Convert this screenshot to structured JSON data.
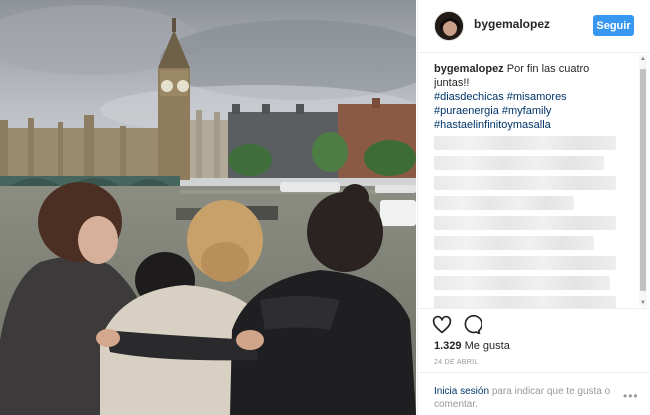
{
  "post": {
    "image_alt": "",
    "username": "bygemalopez",
    "follow_label": "Seguir",
    "caption_user": "bygemalopez",
    "caption_text": "Por fin las cuatro juntas!!",
    "hashtags": [
      "#diasdechicas",
      "#misamores",
      "#puraenergia",
      "#myfamily",
      "#hastaelinfinitoymasalla"
    ],
    "likes_count": "1.329",
    "likes_label": "Me gusta",
    "date": "24 DE ABRIL",
    "login_link": "Inicia sesión",
    "login_rest": "para indicar que te gusta o comentar.",
    "more_label": "•••"
  },
  "icons": {
    "like": "heart-icon",
    "comment": "comment-icon",
    "more": "more-options-icon"
  },
  "colors": {
    "follow_button": "#3897f0",
    "link": "#003569",
    "muted": "#999999",
    "text": "#262626",
    "border": "#efefef"
  }
}
